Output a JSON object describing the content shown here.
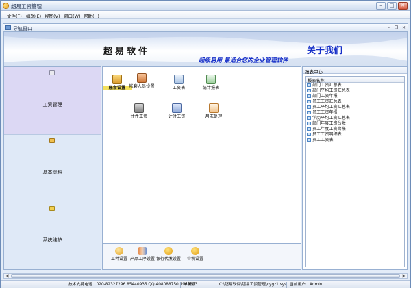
{
  "window": {
    "title": "超易工资管理"
  },
  "menu": [
    "文件(F)",
    "编辑(E)",
    "视图(V)",
    "窗口(W)",
    "帮助(H)"
  ],
  "nav": {
    "title": "导航窗口"
  },
  "banner": {
    "product_name": "超易软件",
    "about_link": "关于我们",
    "slogan": "超级易用 最适合您的企业管理软件"
  },
  "sidebar": [
    {
      "label": "工资管理",
      "active": true,
      "icon": "gear-icon"
    },
    {
      "label": "基本资料",
      "active": false,
      "icon": "card-icon"
    },
    {
      "label": "系统维护",
      "active": false,
      "icon": "tools-icon"
    }
  ],
  "workspace": [
    {
      "label": "账套设置",
      "icon": "folder-icon",
      "selected": true
    },
    {
      "label": "帐套人员设置",
      "icon": "person-icon",
      "selected": false
    },
    {
      "label": "工资表",
      "icon": "sheet-icon",
      "selected": false
    },
    {
      "label": "统计报表",
      "icon": "chart-icon",
      "selected": false
    },
    {
      "label": "计件工资",
      "icon": "bag-icon",
      "selected": false
    },
    {
      "label": "计时工资",
      "icon": "clock-icon",
      "selected": false
    },
    {
      "label": "月末处理",
      "icon": "calendar-icon",
      "selected": false
    }
  ],
  "toolbar_bottom": [
    {
      "label": "工种设置",
      "icon": "key-icon"
    },
    {
      "label": "产品工序设置",
      "icon": "book-icon"
    },
    {
      "label": "银行代发设置",
      "icon": "bank-icon"
    },
    {
      "label": "个税设置",
      "icon": "tax-icon"
    }
  ],
  "reports": {
    "panel_title": "报表中心",
    "column_header": "报表名称",
    "items": [
      "部门工资汇总表",
      "部门平均工资汇总表",
      "部门工资年报",
      "员工工资汇总表",
      "员工平均工资汇总表",
      "员工工资年报",
      "学历平均工资汇总表",
      "部门年度工资台帐",
      "员工年度工资台帐",
      "员工工资明细表",
      "员工工资表"
    ]
  },
  "status": {
    "support": "技术支持电话：020-82327296 85440935 QQ:408088750 1969803",
    "mode": "单机版",
    "db_path": "C:\\超易软件\\超易工资管理\\cygz1.sys",
    "user": "当前用户：Admin"
  },
  "colors": {
    "accent": "#1730c8",
    "selected_highlight": "#f3e05d",
    "active_panel": "#dcd8f4"
  }
}
